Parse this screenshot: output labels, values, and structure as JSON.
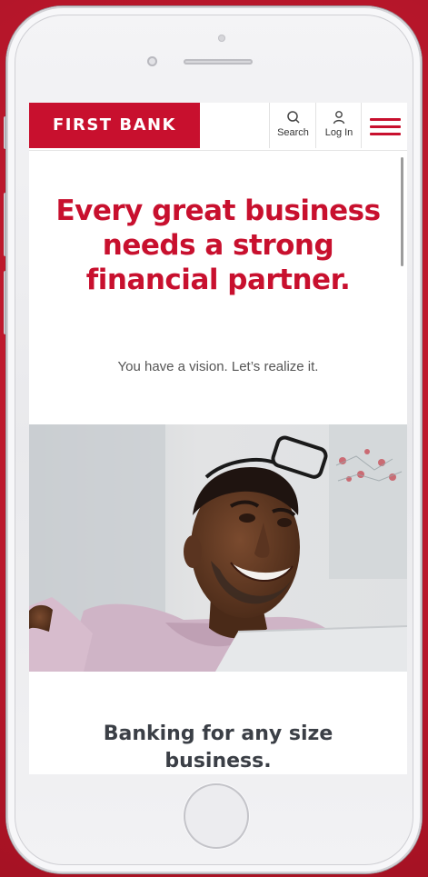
{
  "header": {
    "logo_text": "FIRST BANK",
    "search_label": "Search",
    "login_label": "Log In"
  },
  "hero": {
    "title": "Every great business needs a strong financial partner.",
    "subtitle": "You have a vision. Let’s realize it."
  },
  "section": {
    "title": "Banking for any size business."
  },
  "colors": {
    "brand_red": "#c8102e",
    "background_red": "#b5162a",
    "heading_gray": "#3b3f46"
  },
  "icons": {
    "search": "search-icon",
    "login": "user-icon",
    "menu": "hamburger-menu-icon"
  }
}
